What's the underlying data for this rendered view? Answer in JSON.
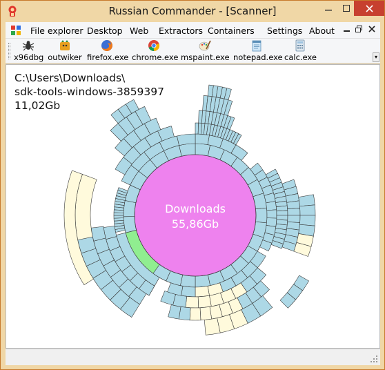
{
  "window": {
    "title": "Russian Commander - [Scanner]"
  },
  "menu": {
    "items": [
      "File explorer",
      "Desktop",
      "Web",
      "Extractors",
      "Containers",
      "Settings",
      "About"
    ]
  },
  "toolbar": {
    "tools": [
      {
        "label": "x96dbg",
        "icon": "bug-icon"
      },
      {
        "label": "outwiker",
        "icon": "outwiker-icon"
      },
      {
        "label": "firefox.exe",
        "icon": "firefox-icon"
      },
      {
        "label": "chrome.exe",
        "icon": "chrome-icon"
      },
      {
        "label": "mspaint.exe",
        "icon": "paint-icon"
      },
      {
        "label": "notepad.exe",
        "icon": "notepad-icon"
      },
      {
        "label": "calc.exe",
        "icon": "calculator-icon"
      }
    ]
  },
  "scanner": {
    "path": "C:\\Users\\Downloads\\",
    "selected_name": "sdk-tools-windows-3859397",
    "selected_size": "11,02Gb",
    "center_label": "Downloads",
    "center_size": "55,86Gb"
  },
  "colors": {
    "center": "#ee82ee",
    "segment": "#add8e6",
    "segment_alt": "#fffadc",
    "selected": "#90ee90",
    "close_button": "#c7402f",
    "titlebar": "#f0d7a6"
  }
}
